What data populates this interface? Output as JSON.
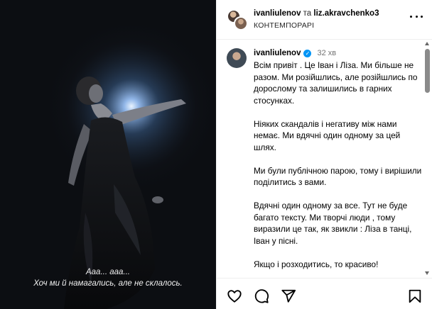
{
  "media": {
    "caption_line1": "Ааа... ааа...",
    "caption_line2": "Хоч ми й намагались, але не склалось."
  },
  "header": {
    "user1": "ivanliulenov",
    "separator": "та",
    "user2": "liz.akravchenko3",
    "audio": "КОНТЕМПОРАРІ"
  },
  "post": {
    "username": "ivanliulenov",
    "verified": true,
    "time": "32 хв",
    "paragraphs": [
      "Всім привіт . Це Іван і Ліза. Ми більше не разом. Ми розійшлись, але розійшлись по дорослому та залишились в гарних стосунках.",
      "Ніяких скандалів і негативу між нами немає. Ми вдячні один одному за цей шлях.",
      "Ми були публічною парою, тому і вирішили поділитись з вами.",
      "Вдячні один одному за все. Тут не буде багато тексту. Ми творчі люди , тому виразили це так, як звикли : Ліза в танці, Іван у пісні.",
      "Якщо і розходитись, то красиво!"
    ]
  },
  "icons": {
    "like": "heart-icon",
    "comment": "comment-icon",
    "share": "send-icon",
    "save": "bookmark-icon",
    "more": "more-icon",
    "verified": "verified-badge-icon"
  },
  "colors": {
    "verified": "#0095f6",
    "muted": "#737373",
    "media_bg": "#0c0e12"
  }
}
